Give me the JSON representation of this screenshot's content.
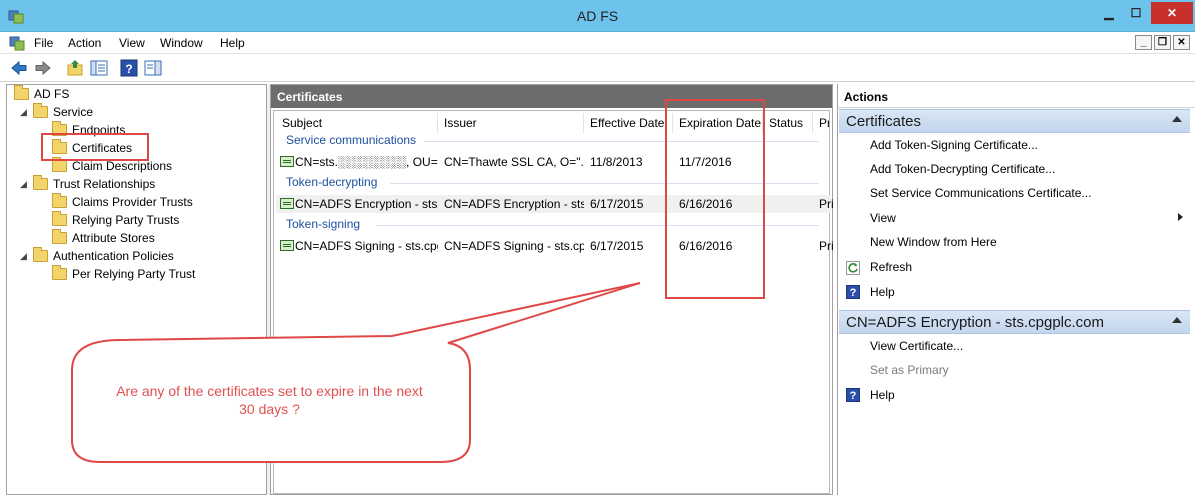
{
  "window": {
    "title": "AD FS",
    "controls": {
      "minimize": "▁",
      "maximize": "☐",
      "close": "✕"
    }
  },
  "menu": {
    "items": [
      "File",
      "Action",
      "View",
      "Window",
      "Help"
    ],
    "child_controls": {
      "minimize": "_",
      "restore": "❐",
      "close": "✕"
    }
  },
  "toolbar": {
    "icons": [
      "back-arrow-icon",
      "forward-arrow-icon",
      "up-folder-icon",
      "show-hide-tree-icon",
      "help-icon",
      "show-hide-action-pane-icon"
    ]
  },
  "tree": {
    "root": "AD FS",
    "service": "Service",
    "endpoints": "Endpoints",
    "certificates": "Certificates",
    "claim_descriptions": "Claim Descriptions",
    "trust_relationships": "Trust Relationships",
    "claims_provider_trusts": "Claims Provider Trusts",
    "relying_party_trusts": "Relying Party Trusts",
    "attribute_stores": "Attribute Stores",
    "authentication_policies": "Authentication Policies",
    "per_relying_party_trust": "Per Relying Party Trust"
  },
  "certificates_pane": {
    "header": "Certificates",
    "columns": {
      "subject": "Subject",
      "issuer": "Issuer",
      "effective_date": "Effective Date",
      "expiration_date": "Expiration Date",
      "status": "Status",
      "primary": "Pri"
    },
    "groups": [
      {
        "label": "Service communications",
        "rows": [
          {
            "subject": "CN=sts.░░░░░░░░, OU=C...",
            "issuer": "CN=Thawte SSL CA, O=\"...",
            "effective": "11/8/2013",
            "expiration": "11/7/2016",
            "status": "",
            "primary": ""
          }
        ]
      },
      {
        "label": "Token-decrypting",
        "rows": [
          {
            "subject": "CN=ADFS Encryption - sts....",
            "issuer": "CN=ADFS Encryption - sts....",
            "effective": "6/17/2015",
            "expiration": "6/16/2016",
            "status": "",
            "primary": "Pri"
          }
        ]
      },
      {
        "label": "Token-signing",
        "rows": [
          {
            "subject": "CN=ADFS Signing - sts.cpg...",
            "issuer": "CN=ADFS Signing - sts.cp...",
            "effective": "6/17/2015",
            "expiration": "6/16/2016",
            "status": "",
            "primary": "Pri"
          }
        ]
      }
    ]
  },
  "actions_pane": {
    "title": "Actions",
    "section1": {
      "header": "Certificates",
      "add_token_signing": "Add Token-Signing Certificate...",
      "add_token_decrypting": "Add Token-Decrypting Certificate...",
      "set_service_comm": "Set Service Communications Certificate...",
      "view": "View",
      "new_window": "New Window from Here",
      "refresh": "Refresh",
      "help": "Help"
    },
    "section2": {
      "header": "CN=ADFS Encryption - sts.cpgplc.com",
      "view_certificate": "View Certificate...",
      "set_as_primary": "Set as Primary",
      "help": "Help"
    }
  },
  "annotation": {
    "callout_line1": "Are any of the certificates set to expire in the next",
    "callout_line2": "30 days ?",
    "color": "#e04848"
  }
}
